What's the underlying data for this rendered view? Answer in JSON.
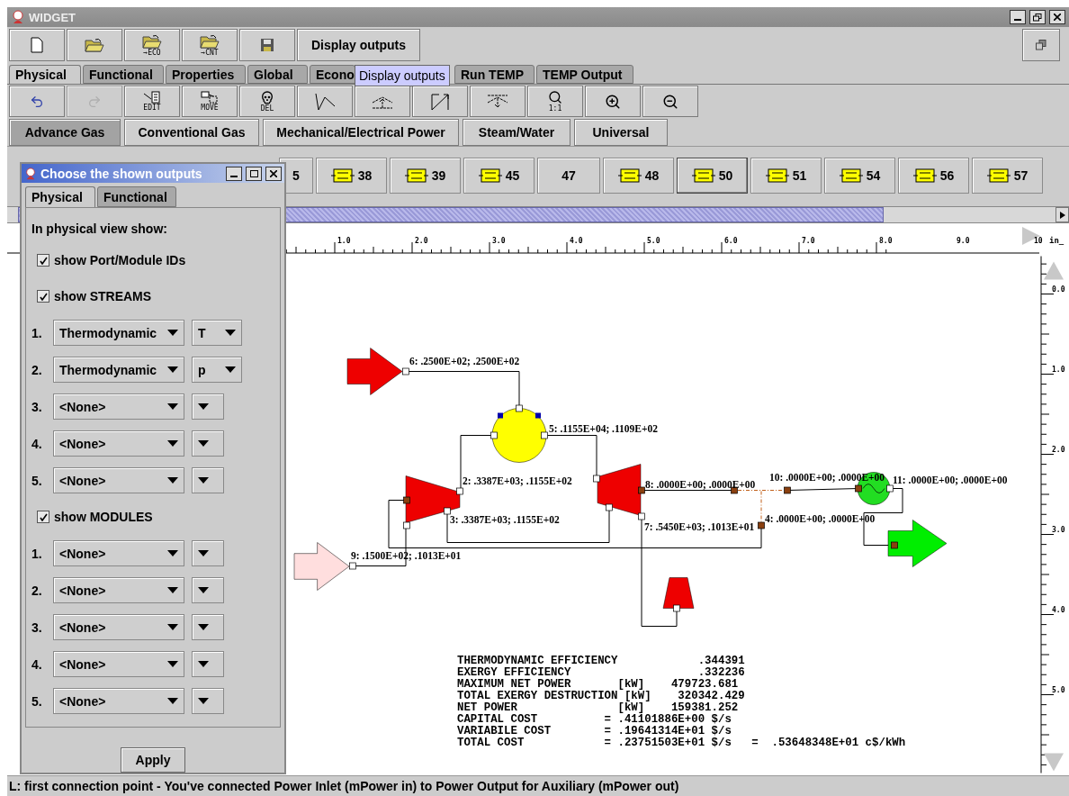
{
  "window": {
    "title": "WIDGET"
  },
  "toolbar": {
    "buttons": [
      {
        "kind": "new"
      },
      {
        "kind": "open"
      },
      {
        "kind": "import",
        "caption": "→ECO"
      },
      {
        "kind": "import",
        "caption": "→CNT"
      },
      {
        "kind": "save"
      }
    ],
    "display_button": "Display outputs"
  },
  "tabs": [
    {
      "label": "Physical",
      "selected": true
    },
    {
      "label": "Functional",
      "selected": false
    },
    {
      "label": "Properties",
      "selected": false
    },
    {
      "label": "Global",
      "selected": false
    },
    {
      "label": "Econo",
      "selected": false
    },
    {
      "label": "Run TEMP",
      "selected": false
    },
    {
      "label": "TEMP Output",
      "selected": false
    }
  ],
  "tooltip": "Display outputs",
  "tools": [
    {
      "kind": "undo",
      "disabled": false
    },
    {
      "kind": "redo",
      "disabled": true
    },
    {
      "kind": "edit",
      "caption": "EDIT",
      "disabled": false
    },
    {
      "kind": "move",
      "caption": "MOVE",
      "disabled": false
    },
    {
      "kind": "delete",
      "caption": "DEL",
      "disabled": false
    },
    {
      "kind": "polyline",
      "disabled": false
    },
    {
      "kind": "connect-up",
      "disabled": false
    },
    {
      "kind": "connect-diagonal",
      "disabled": false
    },
    {
      "kind": "connect-down",
      "disabled": false
    },
    {
      "kind": "zoom-reset",
      "caption": "1:1",
      "disabled": false
    },
    {
      "kind": "zoom-in",
      "disabled": false
    },
    {
      "kind": "zoom-out",
      "disabled": false
    }
  ],
  "categories": [
    {
      "label": "Advance Gas",
      "selected": true
    },
    {
      "label": "Conventional Gas",
      "selected": false
    },
    {
      "label": "Mechanical/Electrical Power",
      "selected": false
    },
    {
      "label": "Steam/Water",
      "selected": false
    },
    {
      "label": "Universal",
      "selected": false
    }
  ],
  "palette": [
    {
      "label": "5",
      "kind": "text",
      "selected": false
    },
    {
      "label": "38",
      "kind": "component",
      "selected": false
    },
    {
      "label": "39",
      "kind": "component",
      "selected": false
    },
    {
      "label": "45",
      "kind": "component",
      "selected": false
    },
    {
      "label": "47",
      "kind": "text",
      "selected": false
    },
    {
      "label": "48",
      "kind": "component",
      "selected": false
    },
    {
      "label": "50",
      "kind": "component",
      "selected": true
    },
    {
      "label": "51",
      "kind": "component",
      "selected": false
    },
    {
      "label": "54",
      "kind": "component",
      "selected": false
    },
    {
      "label": "56",
      "kind": "component",
      "selected": false
    },
    {
      "label": "57",
      "kind": "component",
      "selected": false
    }
  ],
  "ruler": {
    "x_labels": [
      "1.0",
      "2.0",
      "3.0",
      "4.0",
      "5.0",
      "6.0",
      "7.0",
      "8.0",
      "9.0",
      "10"
    ],
    "unit": "in_",
    "y_labels": [
      "0.0",
      "1.0",
      "2.0",
      "3.0",
      "4.0",
      "5.0"
    ]
  },
  "diagram": {
    "stream_labels": [
      "6: .2500E+02; .2500E+02",
      "5: .1155E+04; .1109E+02",
      "2: .3387E+03; .1155E+02",
      "3: .3387E+03; .1155E+02",
      "8: .0000E+00; .0000E+00",
      "10: .0000E+00; .0000E+00",
      "11: .0000E+00; .0000E+00",
      "4: .0000E+00; .0000E+00",
      "7: .5450E+03; .1013E+01",
      "9: .1500E+02; .1013E+01"
    ]
  },
  "results": {
    "lines": [
      "THERMODYNAMIC EFFICIENCY            .344391",
      "EXERGY EFFICIENCY                   .332236",
      "MAXIMUM NET POWER       [kW]    479723.681",
      "TOTAL EXERGY DESTRUCTION [kW]    320342.429",
      "NET POWER               [kW]    159381.252",
      "CAPITAL COST          = .41101886E+00 $/s",
      "VARIABILE COST        = .19641314E+01 $/s",
      "TOTAL COST            = .23751503E+01 $/s   =  .53648348E+01 c$/kWh"
    ]
  },
  "status_bar": "L: first connection point - You've connected Power Inlet (mPower in) to Power Output for Auxiliary (mPower out)",
  "dialog": {
    "title": "Choose the shown outputs",
    "tabs": [
      {
        "label": "Physical",
        "selected": true
      },
      {
        "label": "Functional",
        "selected": false
      }
    ],
    "heading": "In physical view show:",
    "show_ids": {
      "label": "show Port/Module IDs",
      "checked": true
    },
    "show_streams": {
      "label": "show STREAMS",
      "checked": true
    },
    "stream_rows": [
      {
        "index": "1.",
        "quantity": "Thermodynamic",
        "variable": "T"
      },
      {
        "index": "2.",
        "quantity": "Thermodynamic",
        "variable": "p"
      },
      {
        "index": "3.",
        "quantity": "<None>"
      },
      {
        "index": "4.",
        "quantity": "<None>"
      },
      {
        "index": "5.",
        "quantity": "<None>"
      }
    ],
    "show_modules": {
      "label": "show MODULES",
      "checked": true
    },
    "module_rows": [
      {
        "index": "1.",
        "quantity": "<None>"
      },
      {
        "index": "2.",
        "quantity": "<None>"
      },
      {
        "index": "3.",
        "quantity": "<None>"
      },
      {
        "index": "4.",
        "quantity": "<None>"
      },
      {
        "index": "5.",
        "quantity": "<None>"
      }
    ],
    "apply": "Apply"
  }
}
